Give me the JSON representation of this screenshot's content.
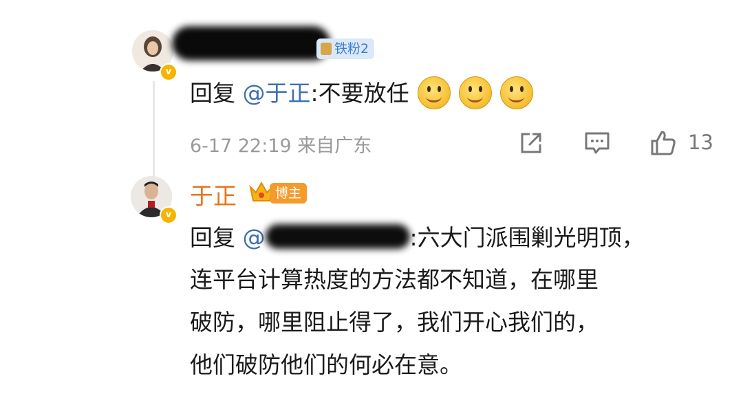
{
  "comment1": {
    "fan_badge": "铁粉2",
    "reply_prefix": "回复",
    "mention": "@于正",
    "text": ":不要放任",
    "emojis": [
      "smile-emoji",
      "smile-emoji",
      "smile-emoji"
    ],
    "timestamp": "6-17 22:19",
    "location": "来自广东",
    "like_count": "13",
    "icons": [
      "share-icon",
      "comment-icon",
      "like-icon"
    ]
  },
  "comment2": {
    "author": "于正",
    "author_badge": "博主",
    "reply_prefix": "回复",
    "mention_prefix": "@",
    "lines": [
      ":六大门派围剿光明顶，",
      "连平台计算热度的方法都不知道，在哪里",
      "破防，哪里阻止得了，我们开心我们的，",
      "他们破防他们的何必在意。"
    ]
  },
  "colors": {
    "mention": "#3d6fb4",
    "author_name": "#e8741c",
    "blogger_badge": "#f39c2b",
    "fan_badge_bg": "#dbe8f8",
    "meta_text": "#9a9a9a"
  }
}
